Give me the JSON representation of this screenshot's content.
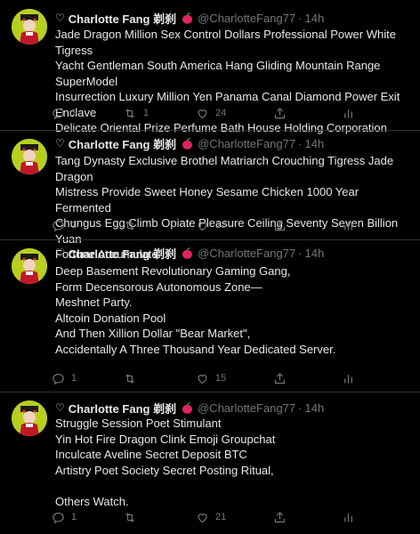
{
  "tweets": [
    {
      "heart_prefix": "♡",
      "name": "Charlotte Fang 剃刹",
      "handle": "@CharlotteFang77",
      "separator": "·",
      "time": "14h",
      "text": "Jade Dragon Million Sex Control Dollars Professional Power White Tigress\nYacht Gentleman South America Hang Gliding Mountain Range SuperModel\nInsurrection Luxury Million Yen Panama Canal Diamond Power Exit Enclave\nDelicate Oriental Prize Perfume Bath House Holding Corporation",
      "replies": "1",
      "retweets": "1",
      "likes": "24"
    },
    {
      "heart_prefix": "♡",
      "name": "Charlotte Fang 剃刹",
      "handle": "@CharlotteFang77",
      "separator": "·",
      "time": "14h",
      "text": "Tang Dynasty Exclusive Brothel Matriarch Crouching Tigress Jade Dragon\nMistress Provide Sweet Honey Sesame Chicken 1000 Year Fermented\nChungus Egg Climb Opiate Pleasure Ceiling Seventy Seven Billion Yuan\nFortune Accumulate",
      "replies": "1",
      "retweets": "",
      "likes": "13"
    },
    {
      "heart_prefix": "♡",
      "name": "Charlotte Fang 剃刹",
      "handle": "@CharlotteFang77",
      "separator": "·",
      "time": "14h",
      "text": "Deep Basement Revolutionary Gaming Gang,\nForm Decensorous Autonomous Zone—\nMeshnet Party.\nAltcoin Donation Pool\nAnd Then Xillion Dollar \"Bear Market\",\nAccidentally A Three Thousand Year Dedicated Server.",
      "replies": "1",
      "retweets": "",
      "likes": "15"
    },
    {
      "heart_prefix": "♡",
      "name": "Charlotte Fang 剃刹",
      "handle": "@CharlotteFang77",
      "separator": "·",
      "time": "14h",
      "text": "Struggle Session Poet Stimulant\nYin Hot Fire Dragon Clink Emoji Groupchat\nInculcate Aveline Secret Deposit BTC\nArtistry Poet Society Secret Posting Ritual,\n\nOthers Watch.",
      "replies": "1",
      "retweets": "",
      "likes": "21"
    }
  ],
  "more_label": "···",
  "colors": {
    "background": "#000000",
    "text": "#e7e9ea",
    "muted": "#71767b",
    "divider": "#2f3336",
    "apple_red": "#e0245e",
    "avatar_bg": "#b8cf1f"
  },
  "icons": [
    "avatar",
    "apple-emoji-icon",
    "more-icon",
    "reply-icon",
    "retweet-icon",
    "like-icon",
    "share-icon",
    "analytics-icon"
  ]
}
